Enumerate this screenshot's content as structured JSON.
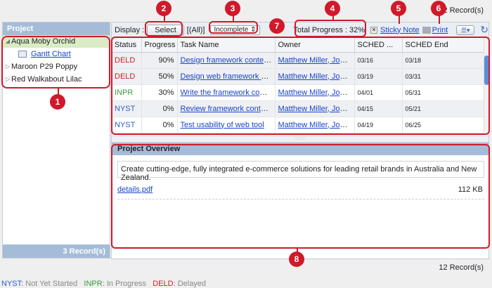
{
  "record_count_top": "12 Record(s)",
  "record_count_bottom": "12 Record(s)",
  "project_panel": {
    "header": "Project",
    "items": [
      {
        "label": "Aqua Moby Orchid"
      },
      {
        "label": "Gantt Chart"
      },
      {
        "label": "Maroon P29 Poppy"
      },
      {
        "label": "Red Walkabout Lilac"
      }
    ],
    "footer": "3 Record(s)"
  },
  "toolbar": {
    "display_label": "Display :",
    "select_button": "Select",
    "all_text": "[(All)]",
    "status_filter": "Incomplete",
    "total_progress": "Total Progress : 32%",
    "sticky_note": "Sticky Note",
    "print": "Print"
  },
  "table": {
    "columns": [
      "Status",
      "Progress",
      "Task Name",
      "Owner",
      "SCHED ...",
      "SCHED End"
    ],
    "rows": [
      {
        "status": "DELD",
        "progress": "90%",
        "task": "Design framework content ...",
        "owner": "Matthew Miller, Josh...",
        "start": "03/16",
        "end": "03/18"
      },
      {
        "status": "DELD",
        "progress": "50%",
        "task": "Design web framework deli...",
        "owner": "Matthew Miller, Josh...",
        "start": "03/19",
        "end": "03/31"
      },
      {
        "status": "INPR",
        "progress": "30%",
        "task": "Write the framework content",
        "owner": "Matthew Miller, Josh...",
        "start": "04/01",
        "end": "05/31"
      },
      {
        "status": "NYST",
        "progress": "0%",
        "task": "Review framework content ...",
        "owner": "Matthew Miller, Josh...",
        "start": "04/15",
        "end": "05/21"
      },
      {
        "status": "NYST",
        "progress": "0%",
        "task": "Test usability of web tool",
        "owner": "Matthew Miller, Josh...",
        "start": "04/19",
        "end": "06/25"
      }
    ]
  },
  "overview": {
    "header": "Project Overview",
    "description": "Create cutting-edge, fully integrated e-commerce solutions for leading retail brands in Australia and New Zealand.",
    "file_name": "details.pdf",
    "file_size": "112 KB"
  },
  "legend": [
    {
      "code": "NYST",
      "text": ": Not Yet Started"
    },
    {
      "code": "INPR",
      "text": ": In Progress"
    },
    {
      "code": "DELD",
      "text": ": Delayed"
    }
  ],
  "callouts": [
    "1",
    "2",
    "3",
    "4",
    "5",
    "6",
    "7",
    "8"
  ],
  "colors": {
    "nyst": "#3060c8",
    "inpr": "#3a9a3a",
    "deld": "#d02020",
    "callout": "#d0192a",
    "panel_header": "#a5bcd8"
  }
}
